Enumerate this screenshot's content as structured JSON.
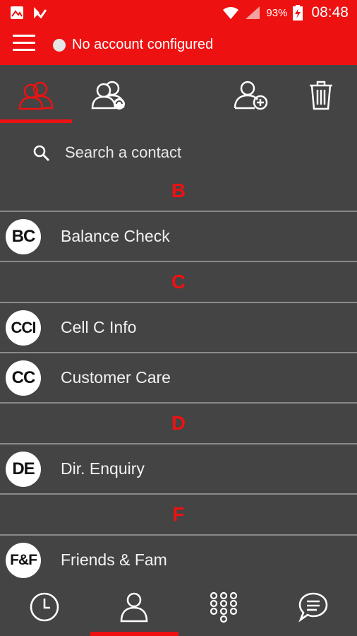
{
  "status_bar": {
    "left_icons": [
      "gallery-icon",
      "download-check-icon"
    ],
    "battery_percent": "93%",
    "time": "08:48"
  },
  "app_bar": {
    "menu_icon": "hamburger-menu-icon",
    "account_status": "No account configured"
  },
  "tabs": [
    {
      "name": "contacts",
      "icon": "contacts-icon",
      "active": true
    },
    {
      "name": "online-contacts",
      "icon": "contacts-online-icon",
      "active": false
    },
    {
      "name": "add-contact",
      "icon": "add-contact-icon",
      "active": false
    },
    {
      "name": "delete",
      "icon": "trash-icon",
      "active": false
    }
  ],
  "search": {
    "placeholder": "Search a contact"
  },
  "sections": [
    {
      "letter": "B",
      "contacts": [
        {
          "initials": "BC",
          "name": "Balance Check"
        }
      ]
    },
    {
      "letter": "C",
      "contacts": [
        {
          "initials": "CCI",
          "name": "Cell C Info"
        },
        {
          "initials": "CC",
          "name": "Customer Care"
        }
      ]
    },
    {
      "letter": "D",
      "contacts": [
        {
          "initials": "DE",
          "name": "Dir. Enquiry"
        }
      ]
    },
    {
      "letter": "F",
      "contacts": [
        {
          "initials": "F&F",
          "name": "Friends & Fam"
        }
      ]
    }
  ],
  "bottom_nav": [
    {
      "name": "history",
      "icon": "clock-icon",
      "active": false
    },
    {
      "name": "contacts",
      "icon": "person-icon",
      "active": true
    },
    {
      "name": "dialpad",
      "icon": "dialpad-icon",
      "active": false
    },
    {
      "name": "chat",
      "icon": "chat-icon",
      "active": false
    }
  ],
  "colors": {
    "accent": "#ee1111",
    "background": "#444444",
    "divider": "#8a8a8a"
  }
}
